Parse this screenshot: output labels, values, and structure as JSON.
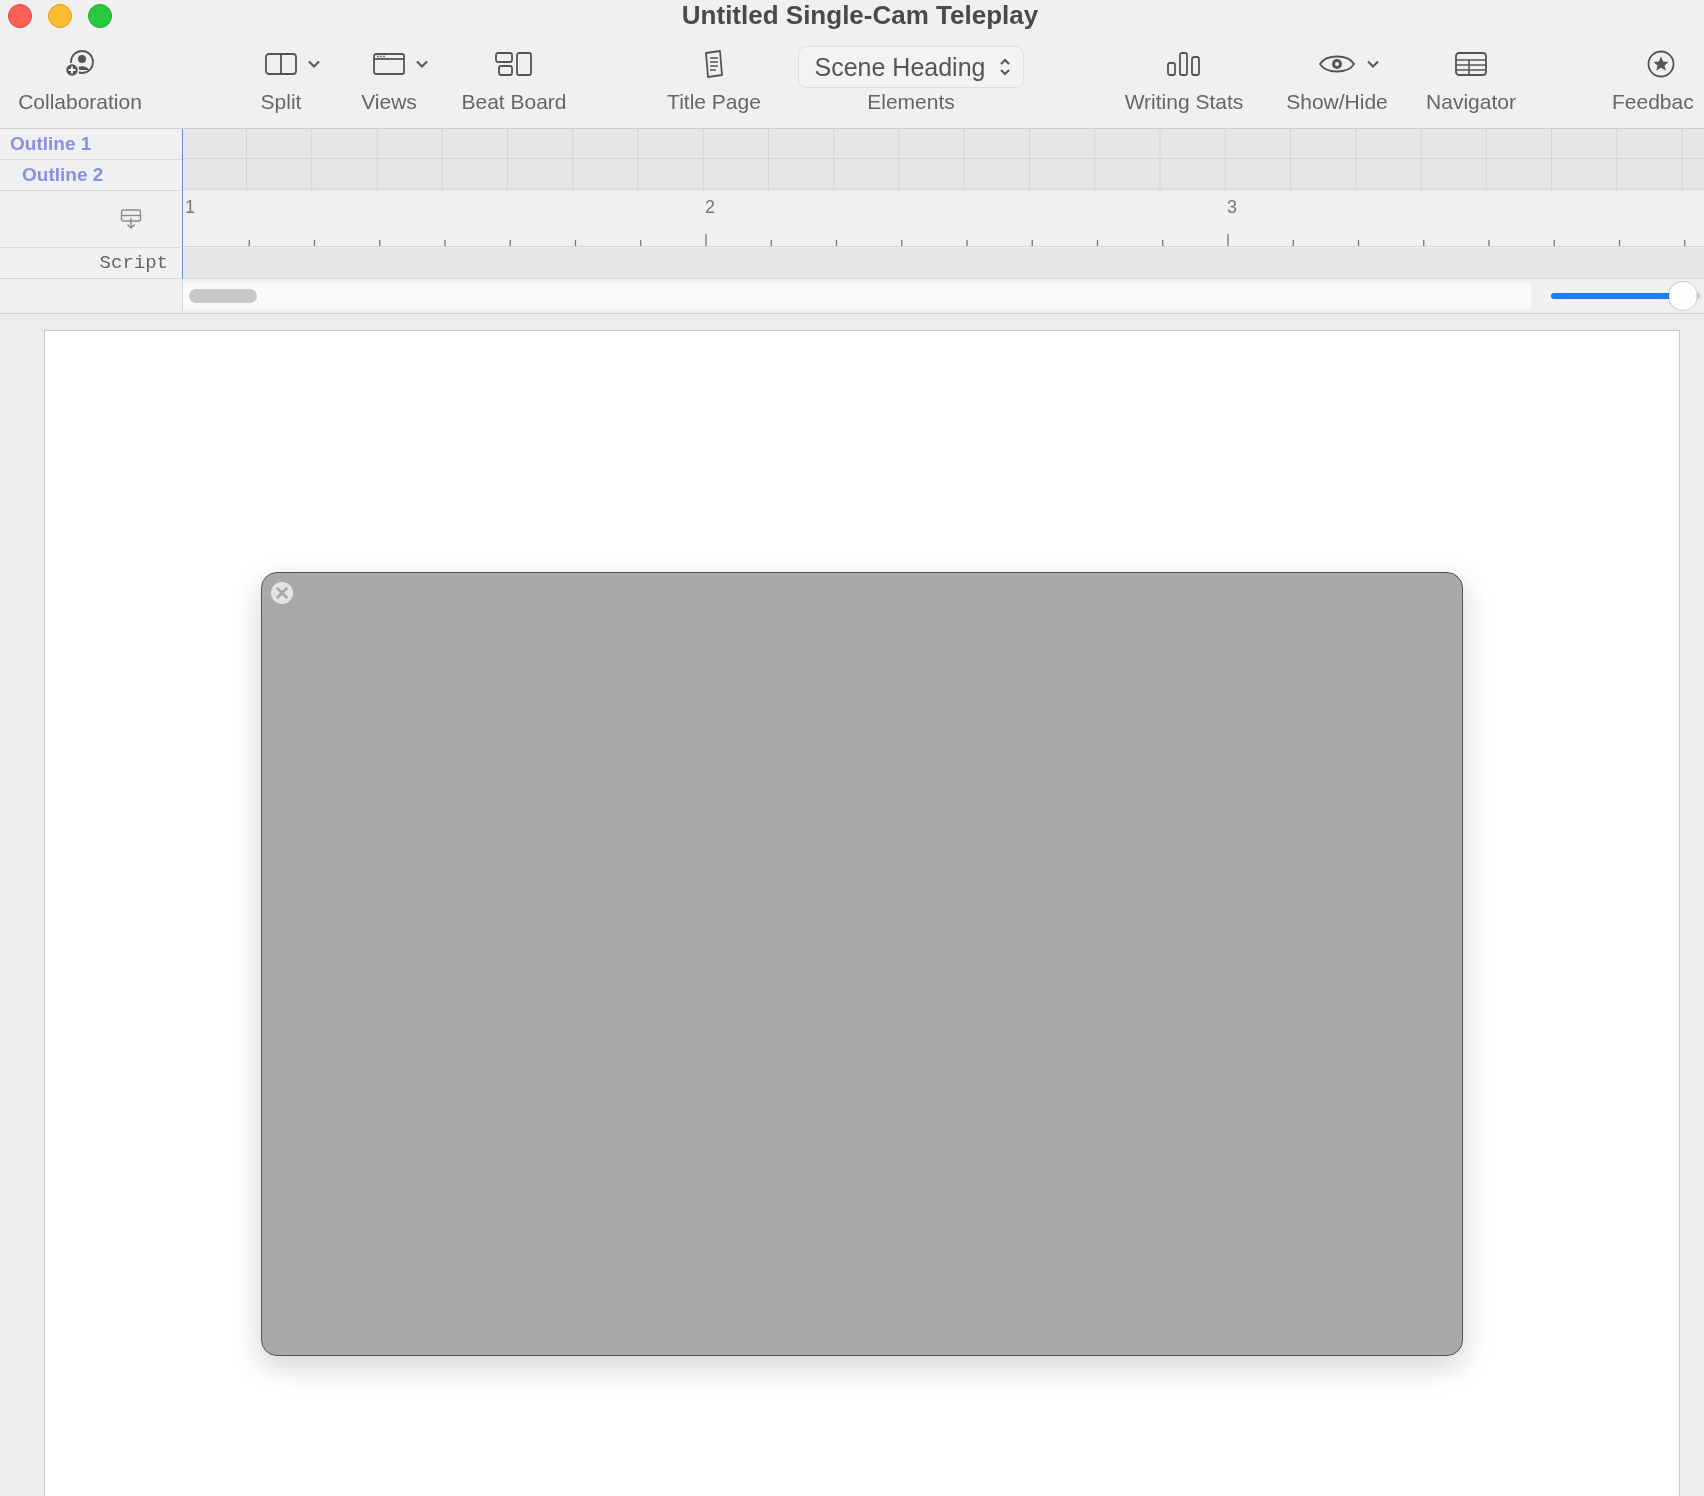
{
  "window": {
    "title": "Untitled Single-Cam Teleplay"
  },
  "toolbar": [
    {
      "kind": "button",
      "label": "Collaboration"
    },
    {
      "kind": "menu",
      "label": "Split"
    },
    {
      "kind": "menu",
      "label": "Views"
    },
    {
      "kind": "button",
      "label": "Beat Board"
    },
    {
      "kind": "button",
      "label": "Title Page"
    },
    {
      "kind": "popup",
      "label": "Elements",
      "value": "Scene Heading"
    },
    {
      "kind": "button",
      "label": "Writing Stats"
    },
    {
      "kind": "menu",
      "label": "Show/Hide"
    },
    {
      "kind": "button",
      "label": "Navigator"
    },
    {
      "kind": "button",
      "label": "Feedbac"
    }
  ],
  "outline": [
    {
      "label": "Outline 1",
      "children": [
        {
          "label": "Outline 2"
        }
      ]
    }
  ],
  "ruler": {
    "labels": [
      "1",
      "2",
      "3"
    ]
  },
  "track": {
    "label": "Script"
  },
  "zoom_slider": {
    "level": 0.97
  }
}
